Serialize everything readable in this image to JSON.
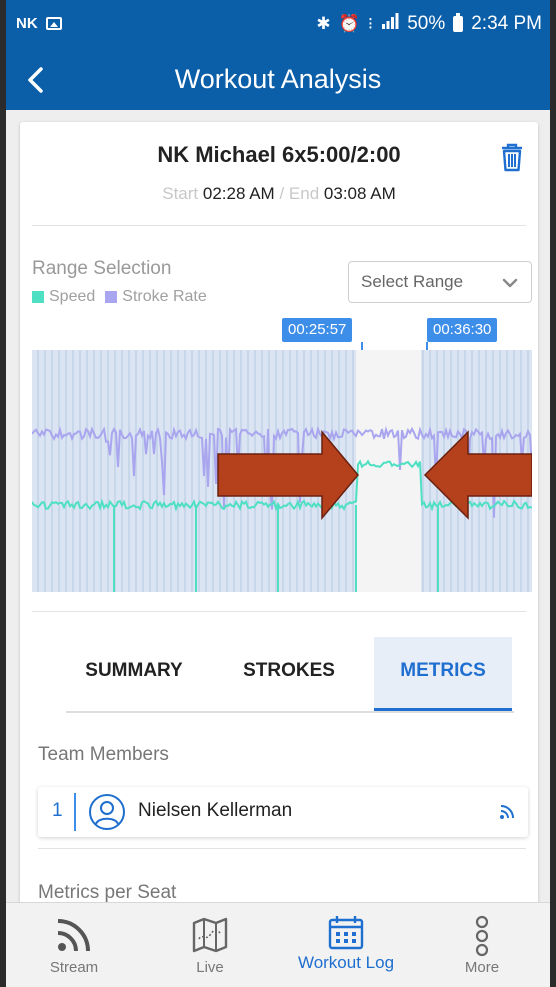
{
  "status_bar": {
    "carrier": "NK",
    "battery": "50%",
    "time": "2:34 PM",
    "icons": [
      "image-icon",
      "bluetooth-icon",
      "alarm-icon",
      "vibrate-icon",
      "signal-icon",
      "battery-icon"
    ]
  },
  "app_bar": {
    "title": "Workout Analysis"
  },
  "workout": {
    "title": "NK Michael 6x5:00/2:00",
    "start_label": "Start",
    "start": "02:28 AM",
    "separator": "/",
    "end_label": "End",
    "end": "03:08 AM"
  },
  "range": {
    "title": "Range Selection",
    "select_label": "Select Range",
    "start_flag": "00:25:57",
    "end_flag": "00:36:30"
  },
  "legend": [
    {
      "name": "Speed",
      "color": "#4fe0c4"
    },
    {
      "name": "Stroke Rate",
      "color": "#a9a5ee"
    }
  ],
  "colors": {
    "primary": "#0b5ea8",
    "accent": "#1e6fcf",
    "flag": "#3d8ee8",
    "arrow": "#b4401c"
  },
  "tabs": [
    {
      "label": "SUMMARY",
      "active": false
    },
    {
      "label": "STROKES",
      "active": false
    },
    {
      "label": "METRICS",
      "active": true
    }
  ],
  "team": {
    "title": "Team Members",
    "members": [
      {
        "seat": "1",
        "name": "Nielsen Kellerman"
      }
    ]
  },
  "metrics_title": "Metrics per Seat",
  "bottom_nav": [
    {
      "label": "Stream",
      "icon": "stream-icon"
    },
    {
      "label": "Live",
      "icon": "map-icon"
    },
    {
      "label": "Workout Log",
      "icon": "calendar-icon",
      "active": true
    },
    {
      "label": "More",
      "icon": "more-icon"
    }
  ]
}
